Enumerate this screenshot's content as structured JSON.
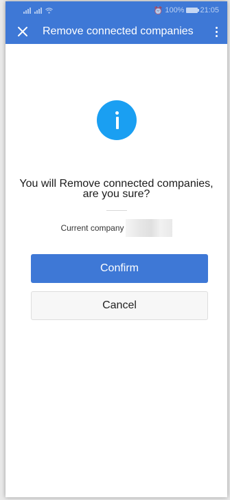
{
  "status_bar": {
    "battery": "100%",
    "time": "21:05"
  },
  "app_bar": {
    "title": "Remove connected companies"
  },
  "dialog": {
    "message_line1": "You will Remove connected companies,",
    "message_line2": "are you sure?",
    "current_company_label": "Current company",
    "confirm_label": "Confirm",
    "cancel_label": "Cancel"
  },
  "colors": {
    "primary": "#3e78d6",
    "info_icon": "#1a9ff2"
  },
  "icons": {
    "close": "close-icon",
    "more": "more-vertical-icon",
    "info": "info-icon"
  }
}
